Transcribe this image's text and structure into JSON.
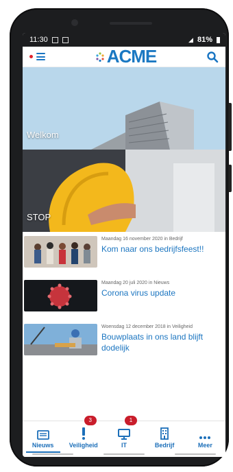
{
  "status": {
    "time": "11:30",
    "battery": "81%"
  },
  "brand": {
    "name": "ACME",
    "color": "#1a78c2"
  },
  "tiles": [
    {
      "label": "Welkom"
    },
    {
      "label": "STOP"
    }
  ],
  "news": [
    {
      "meta": "Maandag 16 november 2020 in Bedrijf",
      "title": "Kom naar ons bedrijfsfeest!!"
    },
    {
      "meta": "Maandag 20 juli 2020 in Nieuws",
      "title": "Corona virus update"
    },
    {
      "meta": "Woensdag 12 december 2018 in Veiligheid",
      "title": "Bouwplaats in ons land blijft dodelijk"
    }
  ],
  "tabs": [
    {
      "label": "Nieuws",
      "icon": "newspaper-icon"
    },
    {
      "label": "Veiligheid",
      "icon": "exclamation-icon",
      "badge": "3"
    },
    {
      "label": "IT",
      "icon": "monitor-icon",
      "badge": "1"
    },
    {
      "label": "Bedrijf",
      "icon": "building-icon"
    },
    {
      "label": "Meer",
      "icon": "more-dots-icon"
    }
  ]
}
